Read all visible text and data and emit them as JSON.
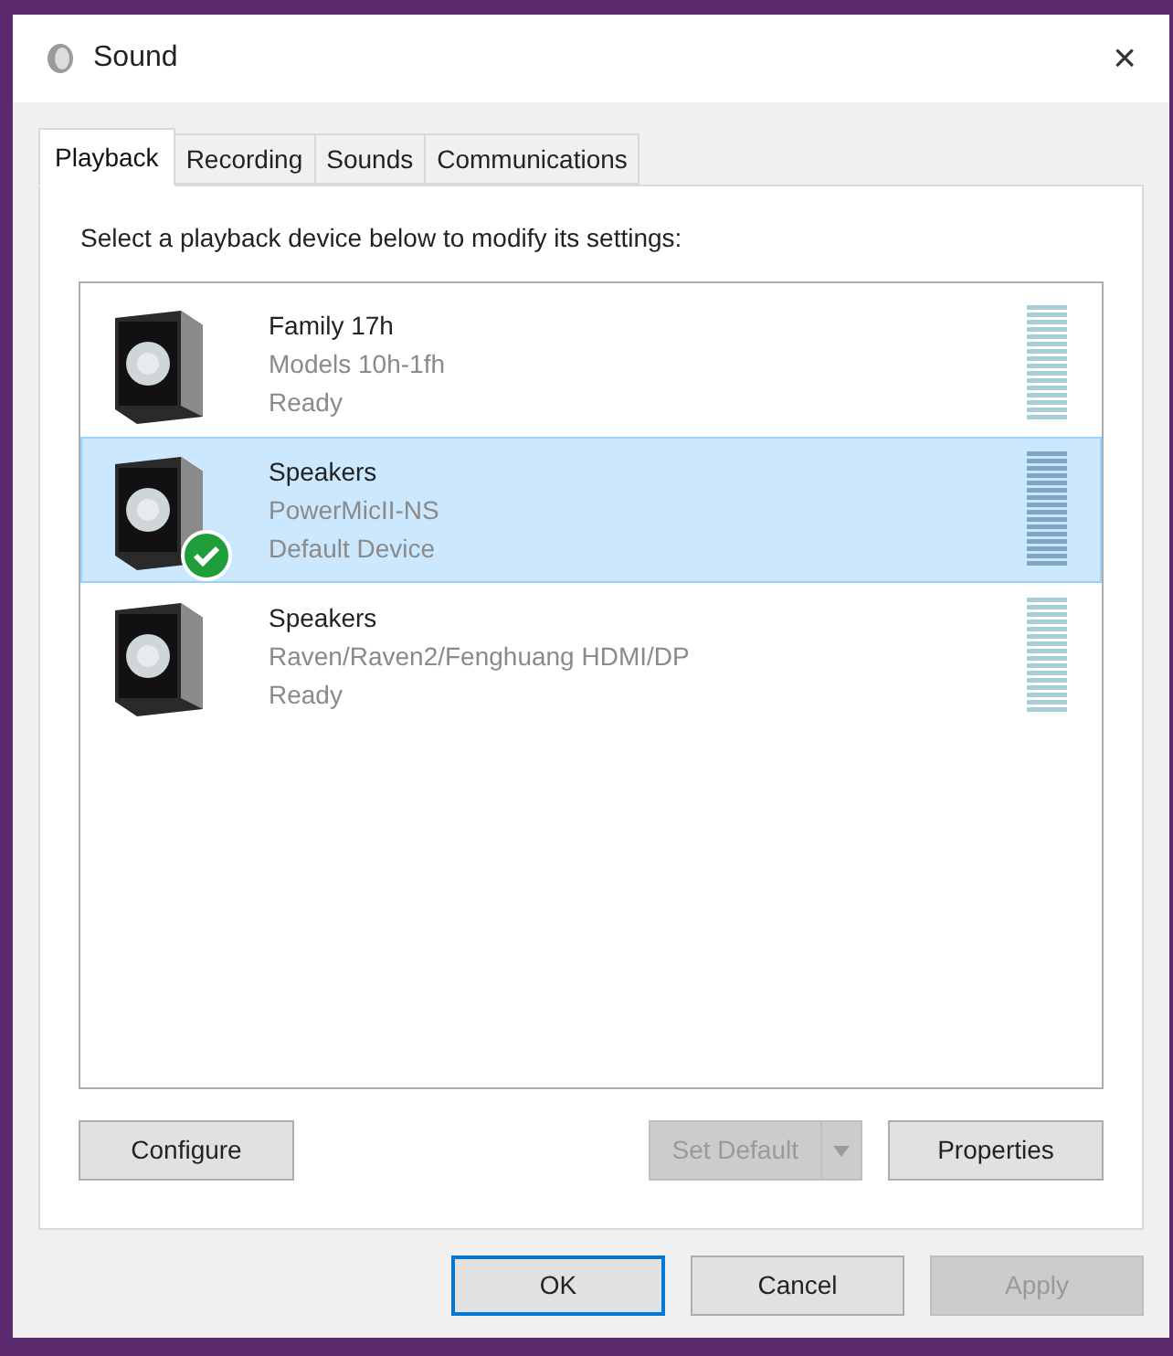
{
  "window": {
    "title": "Sound",
    "close": "×"
  },
  "tabs": [
    {
      "label": "Playback",
      "selected": true
    },
    {
      "label": "Recording",
      "selected": false
    },
    {
      "label": "Sounds",
      "selected": false
    },
    {
      "label": "Communications",
      "selected": false
    }
  ],
  "instruction": "Select a playback device below to modify its settings:",
  "devices": [
    {
      "name": "Family 17h",
      "description": "Models 10h-1fh",
      "status": "Ready",
      "default": false,
      "selected": false
    },
    {
      "name": "Speakers",
      "description": "PowerMicII-NS",
      "status": "Default Device",
      "default": true,
      "selected": true
    },
    {
      "name": "Speakers",
      "description": "Raven/Raven2/Fenghuang HDMI/DP",
      "status": "Ready",
      "default": false,
      "selected": false
    }
  ],
  "panel_buttons": [
    {
      "label": "Configure",
      "kind": "plain",
      "disabled": false
    },
    {
      "label": "Set Default",
      "kind": "split",
      "disabled": true
    },
    {
      "label": "Properties",
      "kind": "plain",
      "disabled": false
    }
  ],
  "dialog_buttons": [
    {
      "label": "OK",
      "default": true,
      "disabled": false
    },
    {
      "label": "Cancel",
      "default": false,
      "disabled": false
    },
    {
      "label": "Apply",
      "default": false,
      "disabled": true
    }
  ]
}
